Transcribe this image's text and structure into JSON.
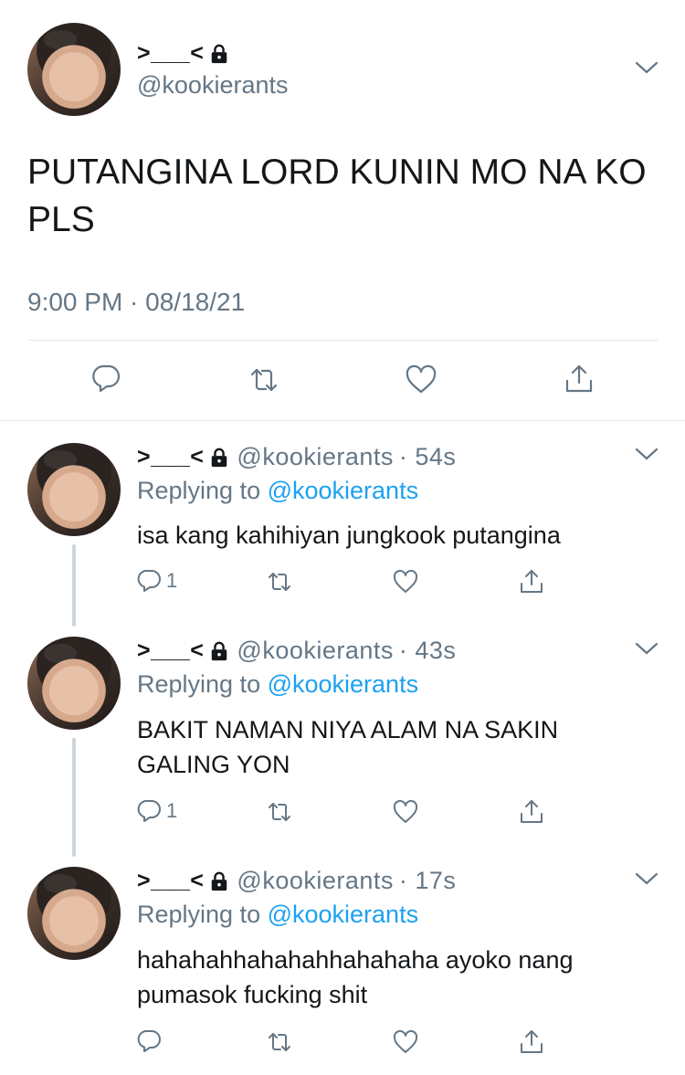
{
  "main_tweet": {
    "display_name": ">___<",
    "handle": "@kookierants",
    "text_line1": "PUTANGINA LORD KUNIN MO NA KO",
    "text_line2": "PLS",
    "timestamp": "9:00 PM · 08/18/21"
  },
  "replies": [
    {
      "display_name": ">___<",
      "handle": "@kookierants",
      "time": "· 54s",
      "replying_prefix": "Replying to ",
      "replying_handle": "@kookierants",
      "text_line1": "isa kang kahihiyan jungkook putangina",
      "text_line2": "",
      "reply_count": "1"
    },
    {
      "display_name": ">___<",
      "handle": "@kookierants",
      "time": "· 43s",
      "replying_prefix": "Replying to ",
      "replying_handle": "@kookierants",
      "text_line1": "BAKIT NAMAN NIYA ALAM NA SAKIN",
      "text_line2": "GALING YON",
      "reply_count": "1"
    },
    {
      "display_name": ">___<",
      "handle": "@kookierants",
      "time": "· 17s",
      "replying_prefix": "Replying to ",
      "replying_handle": "@kookierants",
      "text_line1": "hahahahhahahahhahahaha ayoko nang",
      "text_line2": "pumasok fucking shit",
      "reply_count": ""
    }
  ],
  "colors": {
    "link": "#1da1f2",
    "secondary_text": "#657786",
    "divider": "#e1e8ed"
  }
}
